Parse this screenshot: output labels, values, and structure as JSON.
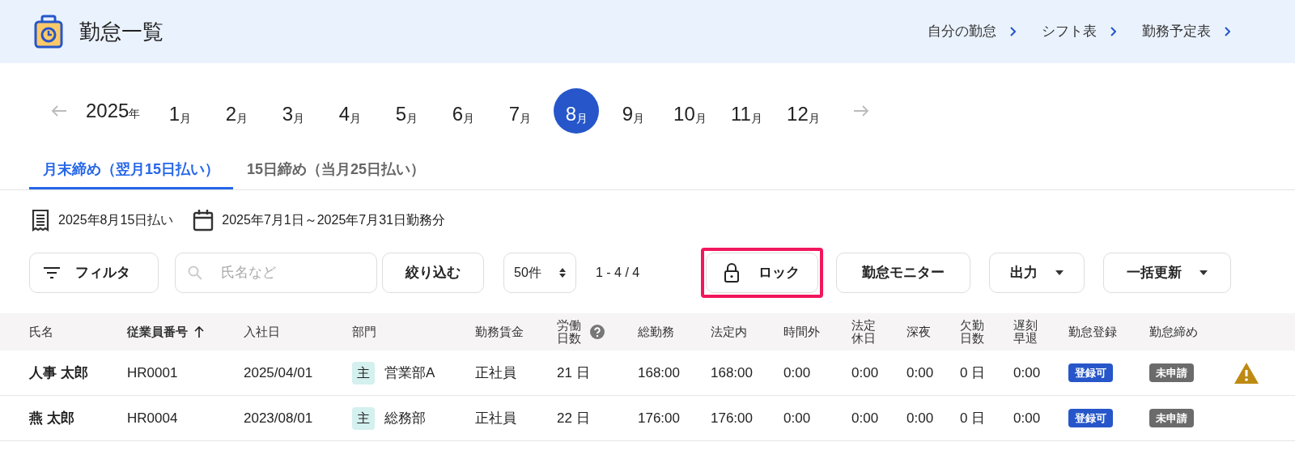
{
  "header": {
    "title": "勤怠一覧",
    "links": [
      "自分の勤怠",
      "シフト表",
      "勤務予定表"
    ]
  },
  "calendar": {
    "prev_disabled": true,
    "next_disabled": true,
    "year": {
      "number": "2025",
      "unit": "年"
    },
    "months": [
      {
        "number": "1",
        "unit": "月",
        "selected": false
      },
      {
        "number": "2",
        "unit": "月",
        "selected": false
      },
      {
        "number": "3",
        "unit": "月",
        "selected": false
      },
      {
        "number": "4",
        "unit": "月",
        "selected": false
      },
      {
        "number": "5",
        "unit": "月",
        "selected": false
      },
      {
        "number": "6",
        "unit": "月",
        "selected": false
      },
      {
        "number": "7",
        "unit": "月",
        "selected": false
      },
      {
        "number": "8",
        "unit": "月",
        "selected": true
      },
      {
        "number": "9",
        "unit": "月",
        "selected": false
      },
      {
        "number": "10",
        "unit": "月",
        "selected": false
      },
      {
        "number": "11",
        "unit": "月",
        "selected": false
      },
      {
        "number": "12",
        "unit": "月",
        "selected": false
      }
    ]
  },
  "tabs": [
    {
      "label": "月末締め（翌月15日払い）",
      "selected": true
    },
    {
      "label": "15日締め（当月25日払い）",
      "selected": false
    }
  ],
  "info": {
    "payday": "2025年8月15日払い",
    "period": "2025年7月1日～2025年7月31日勤務分"
  },
  "toolbar": {
    "filter": "フィルタ",
    "search": {
      "placeholder": "氏名など"
    },
    "apply": "絞り込む",
    "page_size": "50件",
    "range": "1 - 4 / 4",
    "lock": {
      "label": "ロック",
      "highlighted": true
    },
    "monitor": "勤怠モニター",
    "export": "出力",
    "bulk": "一括更新"
  },
  "table": {
    "columns": [
      {
        "label": "氏名",
        "sorted": false
      },
      {
        "label": "従業員番号",
        "sorted": true
      },
      {
        "label": "入社日",
        "sorted": false
      },
      {
        "label": "部門",
        "sorted": false
      },
      {
        "label": "勤務賃金",
        "sorted": false
      },
      {
        "label": "労働日数",
        "sorted": false,
        "help": true
      },
      {
        "label": "総勤務",
        "sorted": false
      },
      {
        "label": "法定内",
        "sorted": false
      },
      {
        "label": "時間外",
        "sorted": false
      },
      {
        "label": "法定休日",
        "sorted": false
      },
      {
        "label": "深夜",
        "sorted": false
      },
      {
        "label": "欠勤日数",
        "sorted": false
      },
      {
        "label": "遅刻早退",
        "sorted": false
      },
      {
        "label": "勤怠登録",
        "sorted": false
      },
      {
        "label": "勤怠締め",
        "sorted": false
      }
    ],
    "rows": [
      {
        "name": "人事 太郎",
        "id": "HR0001",
        "joined": "2025/04/01",
        "dept_tag": "主",
        "dept": "営業部A",
        "wage": "正社員",
        "days": "21 日",
        "total": "168:00",
        "legal": "168:00",
        "overtime": "0:00",
        "holiday": "0:00",
        "night": "0:00",
        "absent": "0 日",
        "late": "0:00",
        "registration": {
          "label": "登録可",
          "color": "#2656c9"
        },
        "closing": {
          "label": "未申請",
          "color": "#6b6b6b"
        },
        "warning": true
      },
      {
        "name": "燕 太郎",
        "id": "HR0004",
        "joined": "2023/08/01",
        "dept_tag": "主",
        "dept": "総務部",
        "wage": "正社員",
        "days": "22 日",
        "total": "176:00",
        "legal": "176:00",
        "overtime": "0:00",
        "holiday": "0:00",
        "night": "0:00",
        "absent": "0 日",
        "late": "0:00",
        "registration": {
          "label": "登録可",
          "color": "#2656c9"
        },
        "closing": {
          "label": "未申請",
          "color": "#6b6b6b"
        },
        "warning": false
      }
    ]
  }
}
